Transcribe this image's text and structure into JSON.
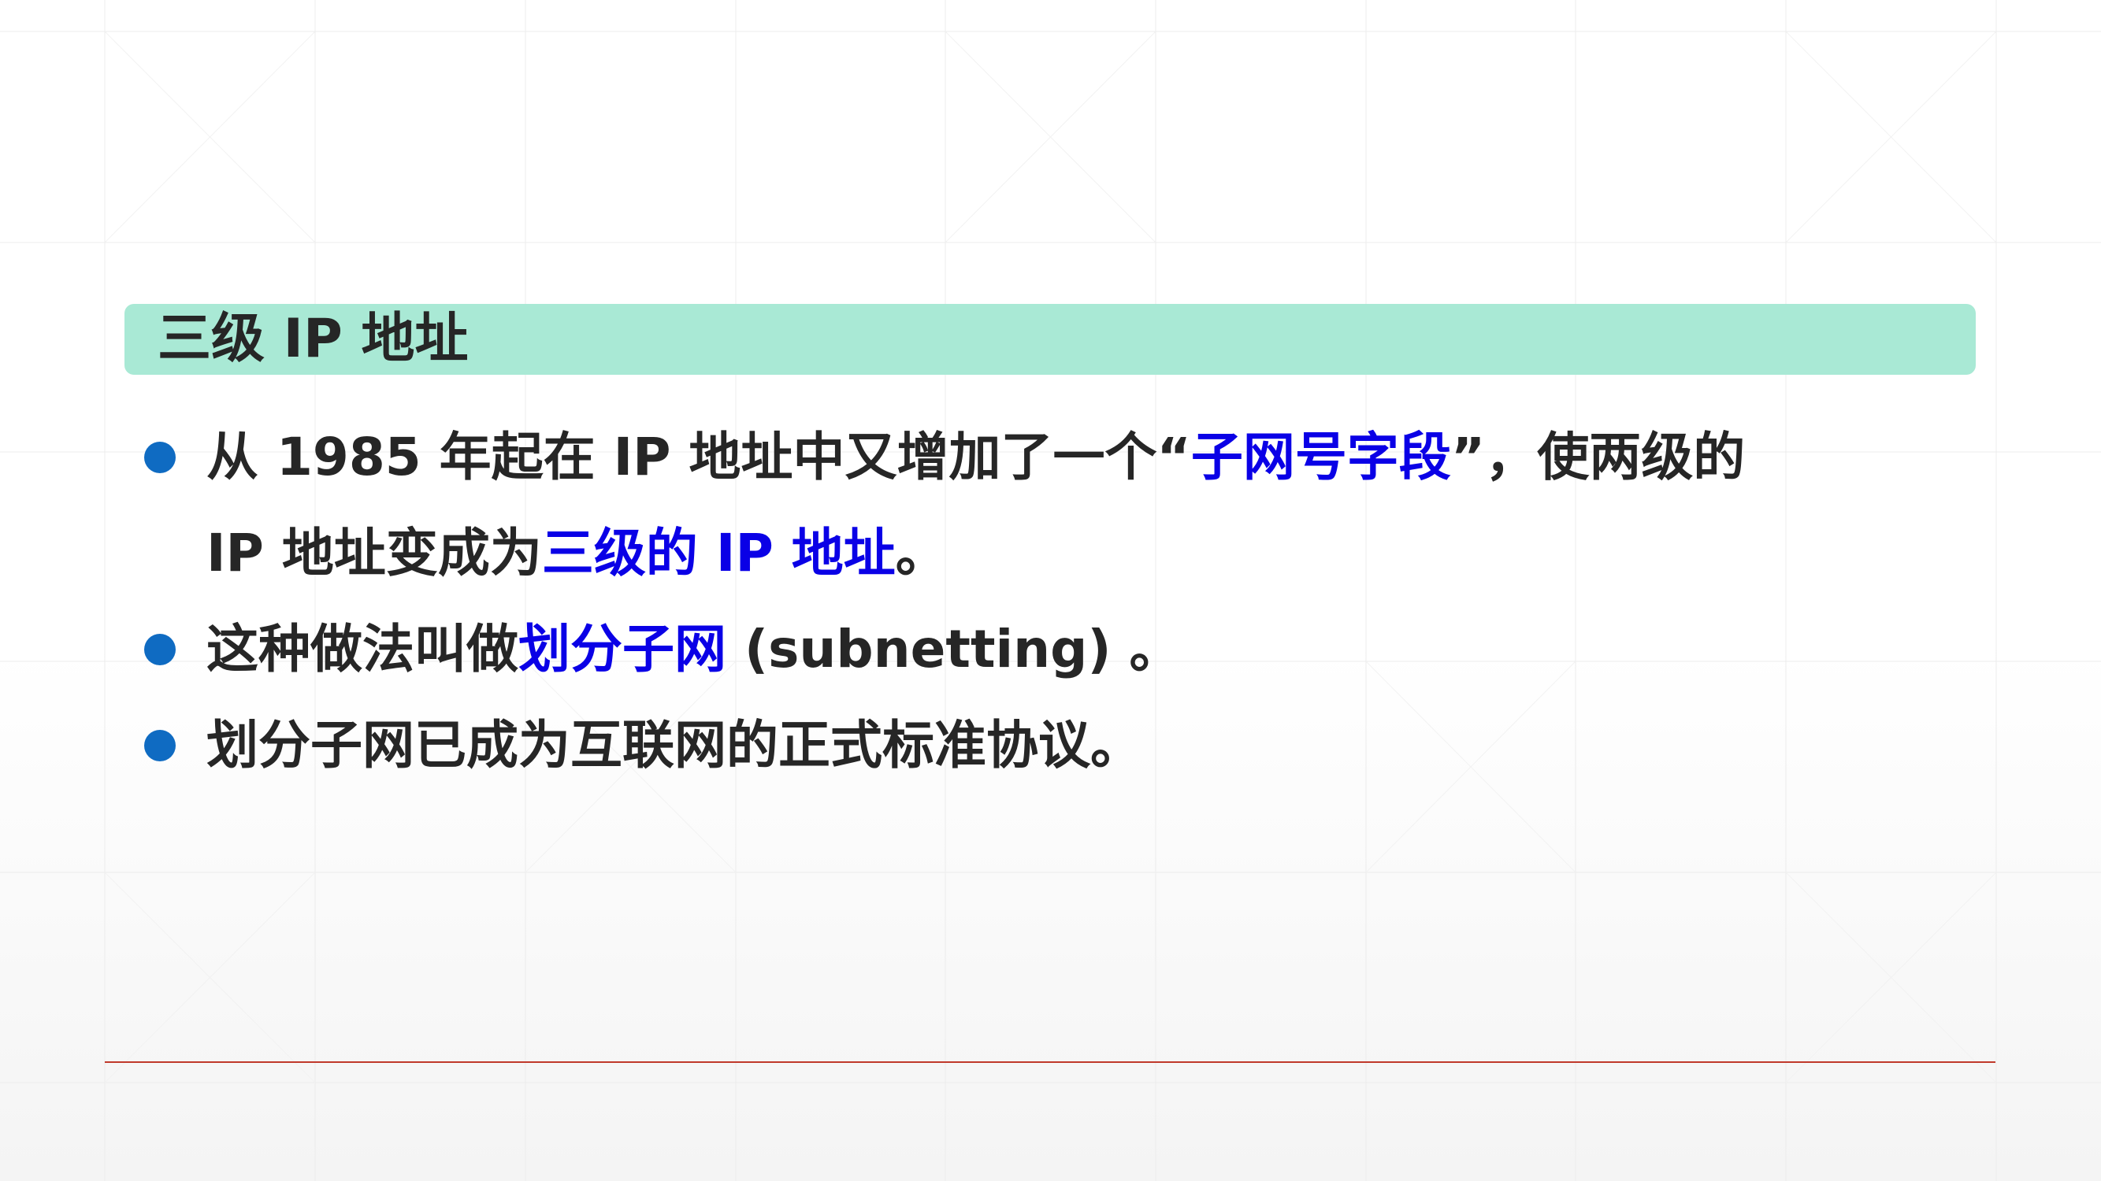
{
  "slide": {
    "title": "三级 IP 地址",
    "bullets": [
      {
        "line1_a": "从 1985 年起在 IP 地址中又增加了一个“",
        "line1_hl": "子网号字段",
        "line1_b": "”，使两级的",
        "line2_a": "IP 地址变成为",
        "line2_hl": "三级的 IP 地址",
        "line2_b": "。"
      },
      {
        "text_a": "这种做法叫做",
        "text_hl": "划分子网",
        "text_b": " (subnetting) 。"
      },
      {
        "text": "划分子网已成为互联网的正式标准协议。"
      }
    ]
  },
  "colors": {
    "title_bar": "#a9e9d5",
    "bullet_dot": "#0f6bc2",
    "highlight_text": "#0a00e6",
    "body_text": "#262626",
    "footer_line": "#c0392b"
  }
}
